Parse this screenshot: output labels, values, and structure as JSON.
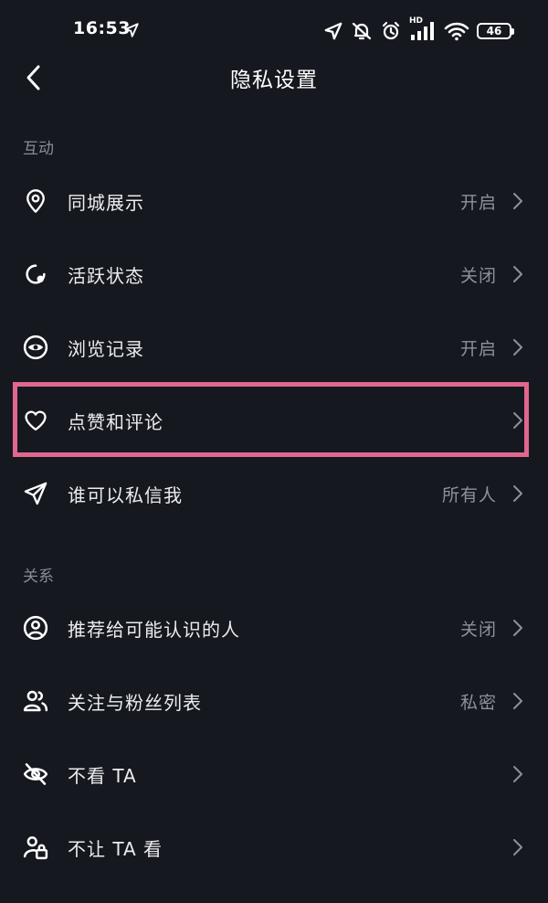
{
  "status_bar": {
    "time": "16:53",
    "battery": "46",
    "signal_badge": "HD"
  },
  "nav": {
    "title": "隐私设置"
  },
  "sections": [
    {
      "header": "互动",
      "items": [
        {
          "label": "同城展示",
          "value": "开启",
          "icon": "location-pin-icon"
        },
        {
          "label": "活跃状态",
          "value": "关闭",
          "icon": "activity-status-icon"
        },
        {
          "label": "浏览记录",
          "value": "开启",
          "icon": "eye-icon"
        },
        {
          "label": "点赞和评论",
          "value": "",
          "icon": "heart-icon"
        },
        {
          "label": "谁可以私信我",
          "value": "所有人",
          "icon": "paper-plane-icon"
        }
      ]
    },
    {
      "header": "关系",
      "items": [
        {
          "label": "推荐给可能认识的人",
          "value": "关闭",
          "icon": "user-circle-icon"
        },
        {
          "label": "关注与粉丝列表",
          "value": "私密",
          "icon": "users-icon"
        },
        {
          "label": "不看 TA",
          "value": "",
          "icon": "eye-off-icon"
        },
        {
          "label": "不让 TA 看",
          "value": "",
          "icon": "user-lock-icon"
        }
      ]
    }
  ],
  "colors": {
    "background": "#16181f",
    "highlight": "#e0678f",
    "secondary_text": "#8f9199"
  }
}
